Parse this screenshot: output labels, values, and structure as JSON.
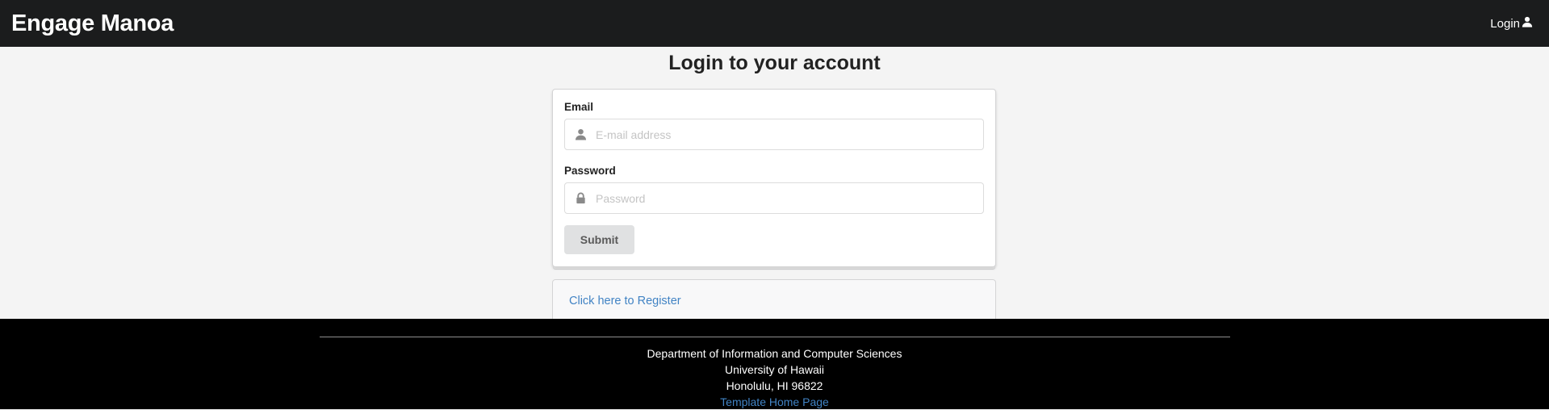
{
  "navbar": {
    "brand": "Engage Manoa",
    "login_label": "Login",
    "login_icon": "user-icon",
    "background": "#1b1c1d"
  },
  "main": {
    "title": "Login to your account",
    "form": {
      "email_label": "Email",
      "email_placeholder": "E-mail address",
      "email_icon": "user-icon",
      "email_value": "",
      "password_label": "Password",
      "password_placeholder": "Password",
      "password_icon": "lock-icon",
      "password_value": "",
      "submit_label": "Submit"
    },
    "register_link": "Click here to Register"
  },
  "footer": {
    "line1": "Department of Information and Computer Sciences",
    "line2": "University of Hawaii",
    "line3": "Honolulu, HI 96822",
    "link": "Template Home Page"
  },
  "colors": {
    "link": "#4183c4",
    "footer_bg": "#000000",
    "page_bg": "#f4f4f4"
  }
}
